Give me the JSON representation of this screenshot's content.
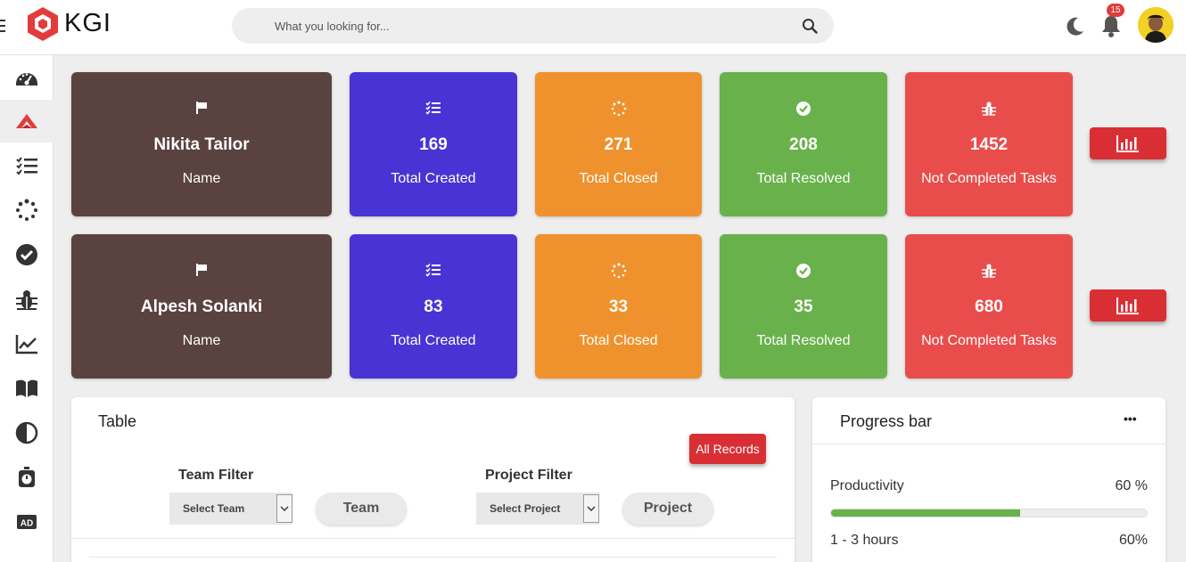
{
  "header": {
    "logo_text": "KGI",
    "search_placeholder": "What you looking for...",
    "notification_count": "15"
  },
  "sidebar": {
    "items": [
      {
        "icon": "dashboard-gauge-icon",
        "active": false
      },
      {
        "icon": "logo-chevron-icon",
        "active": true
      },
      {
        "icon": "task-list-icon",
        "active": false
      },
      {
        "icon": "spinner-dots-icon",
        "active": false
      },
      {
        "icon": "check-circle-icon",
        "active": false
      },
      {
        "icon": "bug-icon",
        "active": false
      },
      {
        "icon": "trend-chart-icon",
        "active": false
      },
      {
        "icon": "book-icon",
        "active": false
      },
      {
        "icon": "contrast-icon",
        "active": false
      },
      {
        "icon": "stopwatch-icon",
        "active": false
      },
      {
        "icon": "ad-icon",
        "active": false
      }
    ]
  },
  "rows": [
    {
      "name": "Nikita Tailor",
      "name_label": "Name",
      "total_created": "169",
      "total_created_label": "Total Created",
      "total_closed": "271",
      "total_closed_label": "Total Closed",
      "total_resolved": "208",
      "total_resolved_label": "Total Resolved",
      "not_completed": "1452",
      "not_completed_label": "Not Completed Tasks"
    },
    {
      "name": "Alpesh Solanki",
      "name_label": "Name",
      "total_created": "83",
      "total_created_label": "Total Created",
      "total_closed": "33",
      "total_closed_label": "Total Closed",
      "total_resolved": "35",
      "total_resolved_label": "Total Resolved",
      "not_completed": "680",
      "not_completed_label": "Not Completed Tasks"
    }
  ],
  "table_panel": {
    "title": "Table",
    "all_records_label": "All Records",
    "team_filter_label": "Team Filter",
    "team_select_value": "Select Team",
    "team_button_label": "Team",
    "project_filter_label": "Project Filter",
    "project_select_value": "Select Project",
    "project_button_label": "Project"
  },
  "progress_panel": {
    "title": "Progress bar",
    "more_label": "•••",
    "items": [
      {
        "label": "Productivity",
        "value_text": "60 %",
        "percent": 60
      },
      {
        "label": "1 - 3 hours",
        "value_text": "60%",
        "percent": 60
      }
    ]
  },
  "colors": {
    "name_card": "#5a4240",
    "created_card": "#4a33d4",
    "closed_card": "#ef922e",
    "resolved_card": "#69b24b",
    "not_completed_card": "#e94d4b",
    "accent_red": "#d92f34"
  }
}
